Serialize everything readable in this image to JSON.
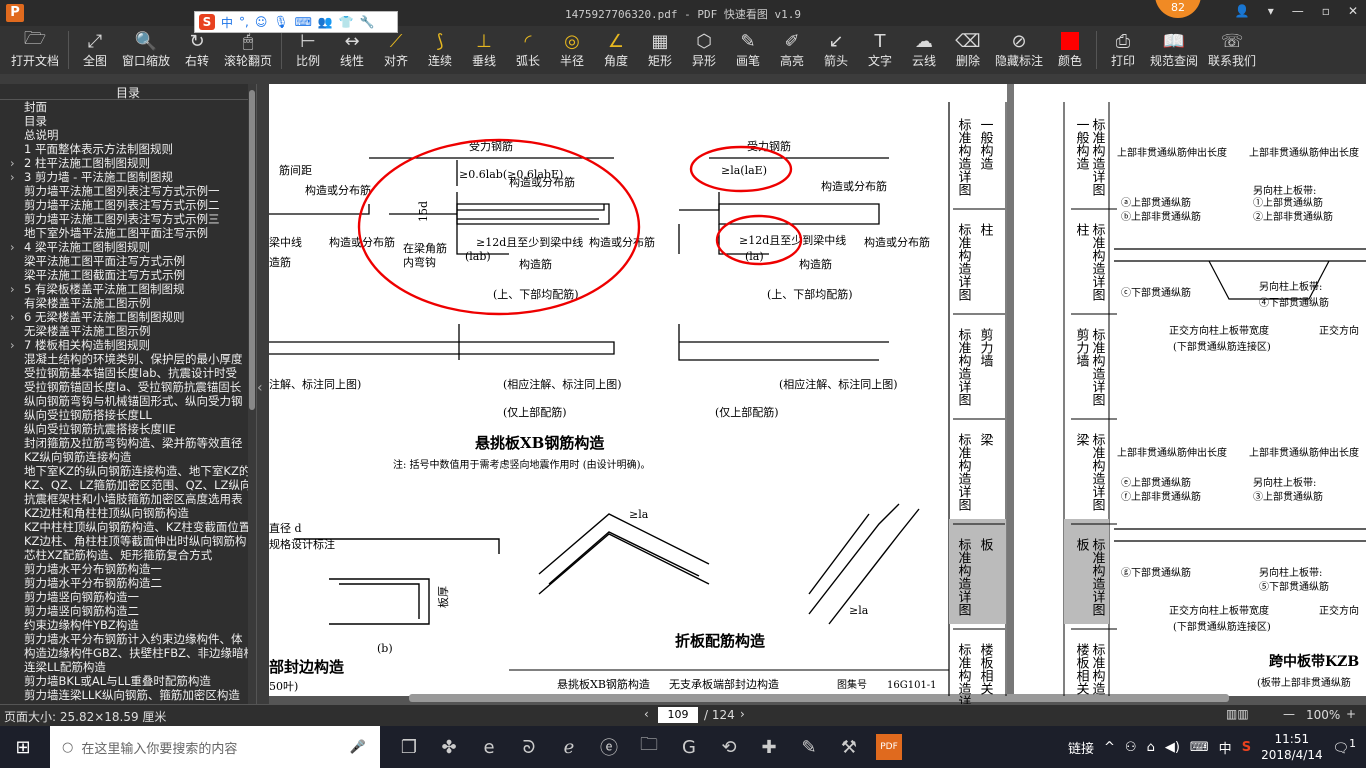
{
  "app": {
    "title": "1475927706320.pdf - PDF 快速看图 v1.9",
    "logo": "P",
    "badge_count": "82"
  },
  "ime": {
    "label": "中",
    "punct": "°,"
  },
  "toolbar": [
    {
      "label": "打开文档",
      "icon": "folder-icon",
      "glyph": "🗁"
    },
    {
      "label": "全图",
      "icon": "fit-icon",
      "glyph": "⤢"
    },
    {
      "label": "窗口缩放",
      "icon": "zoom-icon",
      "glyph": "🔍"
    },
    {
      "label": "右转",
      "icon": "rotate-icon",
      "glyph": "↻"
    },
    {
      "label": "滚轮翻页",
      "icon": "mouse-icon",
      "glyph": "🖱"
    },
    {
      "label": "比例",
      "icon": "scale-icon",
      "glyph": "⊢"
    },
    {
      "label": "线性",
      "icon": "linear-icon",
      "glyph": "↔"
    },
    {
      "label": "对齐",
      "icon": "align-icon",
      "glyph": "⟋"
    },
    {
      "label": "连续",
      "icon": "continuous-icon",
      "glyph": "⟆"
    },
    {
      "label": "垂线",
      "icon": "perpendicular-icon",
      "glyph": "⊥"
    },
    {
      "label": "弧长",
      "icon": "arc-icon",
      "glyph": "◜"
    },
    {
      "label": "半径",
      "icon": "radius-icon",
      "glyph": "◎"
    },
    {
      "label": "角度",
      "icon": "angle-icon",
      "glyph": "∠"
    },
    {
      "label": "矩形",
      "icon": "rectangle-icon",
      "glyph": "▦"
    },
    {
      "label": "异形",
      "icon": "polygon-icon",
      "glyph": "⬡"
    },
    {
      "label": "画笔",
      "icon": "pen-icon",
      "glyph": "✎"
    },
    {
      "label": "高亮",
      "icon": "highlight-icon",
      "glyph": "✐"
    },
    {
      "label": "箭头",
      "icon": "arrow-icon",
      "glyph": "↙"
    },
    {
      "label": "文字",
      "icon": "text-icon",
      "glyph": "T"
    },
    {
      "label": "云线",
      "icon": "cloud-icon",
      "glyph": "☁"
    },
    {
      "label": "删除",
      "icon": "eraser-icon",
      "glyph": "⌫"
    },
    {
      "label": "隐藏标注",
      "icon": "eye-hide-icon",
      "glyph": "⊘"
    },
    {
      "label": "颜色",
      "icon": "color-icon",
      "glyph": ""
    },
    {
      "label": "打印",
      "icon": "print-icon",
      "glyph": "⎙"
    },
    {
      "label": "规范查阅",
      "icon": "book-icon",
      "glyph": "📖"
    },
    {
      "label": "联系我们",
      "icon": "contact-icon",
      "glyph": "☏"
    }
  ],
  "sidebar": {
    "title": "目录",
    "items": [
      {
        "label": "封面",
        "level": 0
      },
      {
        "label": "目录",
        "level": 0
      },
      {
        "label": "总说明",
        "level": 0
      },
      {
        "label": "1 平面整体表示方法制图规则",
        "level": 0
      },
      {
        "label": "2 柱平法施工图制图规则",
        "level": 1
      },
      {
        "label": "3 剪力墙 - 平法施工图制图规",
        "level": 1
      },
      {
        "label": "剪力墙平法施工图列表注写方式示例一",
        "level": 0
      },
      {
        "label": "剪力墙平法施工图列表注写方式示例二",
        "level": 0
      },
      {
        "label": "剪力墙平法施工图列表注写方式示例三",
        "level": 0
      },
      {
        "label": "地下室外墙平法施工图平面注写示例",
        "level": 0
      },
      {
        "label": "4 梁平法施工图制图规则",
        "level": 1
      },
      {
        "label": "梁平法施工图平面注写方式示例",
        "level": 0
      },
      {
        "label": "梁平法施工图截面注写方式示例",
        "level": 0
      },
      {
        "label": "5 有梁板楼盖平法施工图制图规",
        "level": 1
      },
      {
        "label": "有梁楼盖平法施工图示例",
        "level": 0
      },
      {
        "label": "6 无梁楼盖平法施工图制图规则",
        "level": 1
      },
      {
        "label": "无梁楼盖平法施工图示例",
        "level": 0
      },
      {
        "label": "7 楼板相关构造制图规则",
        "level": 1
      },
      {
        "label": "混凝土结构的环境类别、保护层的最小厚度",
        "level": 0
      },
      {
        "label": "受拉钢筋基本锚固长度lab、抗震设计时受",
        "level": 0
      },
      {
        "label": "受拉钢筋锚固长度la、受拉钢筋抗震锚固长",
        "level": 0
      },
      {
        "label": "纵向钢筋弯钩与机械锚固形式、纵向受力钢",
        "level": 0
      },
      {
        "label": "纵向受拉钢筋搭接长度LL",
        "level": 0
      },
      {
        "label": "纵向受拉钢筋抗震搭接长度llE",
        "level": 0
      },
      {
        "label": "封闭箍筋及拉筋弯钩构造、梁并筋等效直径",
        "level": 0
      },
      {
        "label": "KZ纵向钢筋连接构造",
        "level": 0
      },
      {
        "label": "地下室KZ的纵向钢筋连接构造、地下室KZ的",
        "level": 0
      },
      {
        "label": "KZ、QZ、LZ箍筋加密区范围、QZ、LZ纵向钢",
        "level": 0
      },
      {
        "label": "抗震框架柱和小墙肢箍筋加密区高度选用表",
        "level": 0
      },
      {
        "label": "KZ边柱和角柱柱顶纵向钢筋构造",
        "level": 0
      },
      {
        "label": "KZ中柱柱顶纵向钢筋构造、KZ柱变截面位置",
        "level": 0
      },
      {
        "label": "KZ边柱、角柱柱顶等截面伸出时纵向钢筋构",
        "level": 0
      },
      {
        "label": "芯柱XZ配筋构造、矩形箍筋复合方式",
        "level": 0
      },
      {
        "label": "剪力墙水平分布钢筋构造一",
        "level": 0
      },
      {
        "label": "剪力墙水平分布钢筋构造二",
        "level": 0
      },
      {
        "label": "剪力墙竖向钢筋构造一",
        "level": 0
      },
      {
        "label": "剪力墙竖向钢筋构造二",
        "level": 0
      },
      {
        "label": "约束边缘构件YBZ构造",
        "level": 0
      },
      {
        "label": "剪力墙水平分布钢筋计入约束边缘构件、体",
        "level": 0
      },
      {
        "label": "构造边缘构件GBZ、扶壁柱FBZ、非边缘暗柱",
        "level": 0
      },
      {
        "label": "连梁LL配筋构造",
        "level": 0
      },
      {
        "label": "剪力墙BKL或AL与LL重叠时配筋构造",
        "level": 0
      },
      {
        "label": "剪力墙连梁LLK纵向钢筋、箍筋加密区构造",
        "level": 0
      }
    ]
  },
  "drawing": {
    "title_main": "悬挑板XB钢筋构造",
    "title_fold": "折板配筋构造",
    "title_edge": "部封边构造",
    "note": "注: 括号中数值用于需考虑竖向地震作用时 (由设计明确)。",
    "force_bar": "受力钢筋",
    "dist_bar": "构造或分布筋",
    "beam_center": "梁中线",
    "corner_hook": "在梁角筋",
    "inner_hook": "内弯钩",
    "anchor_a": "≥0.6lab(≥0.6labE)",
    "anchor_b": "≥12d且至少到梁中线",
    "anchor_c": "≥la(laE)",
    "fifteen_d": "15d",
    "lab": "(lab)",
    "la": "(la)",
    "both_bars": "(上、下部均配筋)",
    "top_only": "(仅上部配筋)",
    "same_note": "(相应注解、标注同上图)",
    "same_note_b": "注解、标注同上图)",
    "dia_d": "直径 d",
    "spec_note": "规格设计标注",
    "label_b": "(b)",
    "plate_thk": "板厚",
    "ge_la": "≥la",
    "thk_short": "50叶)",
    "footer_a": "悬挑板XB钢筋构造",
    "footer_b": "无支承板端部封边构造",
    "atlas": "图集号",
    "atlas_no": "16G101-1",
    "side_tabs": [
      {
        "a": "标准构造详图",
        "b": "一般构造"
      },
      {
        "a": "标准构造详图",
        "b": "柱"
      },
      {
        "a": "标准构造详图",
        "b": "剪力墙"
      },
      {
        "a": "标准构造详图",
        "b": "梁"
      },
      {
        "a": "标准构造详图",
        "b": "板"
      },
      {
        "a": "标准构造详图",
        "b": "楼板相关"
      }
    ],
    "right_tabs": [
      {
        "a": "一般构造",
        "b": "标准构造详图"
      },
      {
        "a": "柱",
        "b": "标准构造详图"
      },
      {
        "a": "剪力墙",
        "b": "标准构造详图"
      },
      {
        "a": "梁",
        "b": "标准构造详图"
      },
      {
        "a": "板",
        "b": "标准构造详图"
      },
      {
        "a": "楼板相关",
        "b": "标准构造"
      }
    ],
    "rp_top_a": "上部非贯通纵筋伸出长度",
    "rp_top_b": "上部非贯通纵筋伸出长度",
    "rp_a": "ⓐ上部贯通纵筋",
    "rp_b": "ⓑ上部非贯通纵筋",
    "rp_other": "另向柱上板带:",
    "rp_1": "①上部贯通纵筋",
    "rp_2": "②上部非贯通纵筋",
    "rp_c": "ⓒ下部贯通纵筋",
    "rp_other2": "另向柱上板带:",
    "rp_4": "④下部贯通纵筋",
    "rp_ortho": "正交方向柱上板带宽度",
    "rp_ortho2": "正交方向",
    "rp_zone": "(下部贯通纵筋连接区)",
    "rp_e": "ⓔ上部贯通纵筋",
    "rp_f": "ⓕ上部非贯通纵筋",
    "rp_3": "③上部贯通纵筋",
    "rp_g": "ⓖ下部贯通纵筋",
    "rp_5": "⑤下部贯通纵筋",
    "rp_bottom_title": "跨中板带KZB",
    "rp_bottom_note": "(板带上部非贯通纵筋",
    "ge_la_short": "≥la"
  },
  "status": {
    "page_size": "页面大小: 25.82×18.59 厘米",
    "current_page": "109",
    "total_pages": "/ 124",
    "zoom": "100%"
  },
  "taskbar": {
    "search_placeholder": "在这里输入你要搜索的内容",
    "tray_label": "链接",
    "ime_lang": "中",
    "time": "11:51",
    "date": "2018/4/14",
    "notif_count": "1",
    "pdf_label": "PDF"
  }
}
